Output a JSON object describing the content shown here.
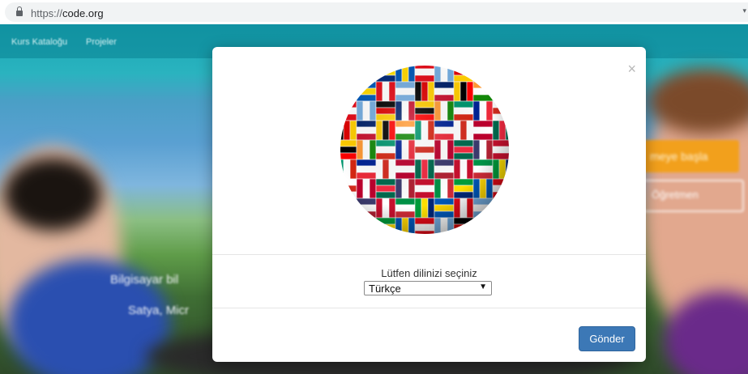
{
  "browser": {
    "url_scheme": "https://",
    "url_host": "code.org",
    "lock_icon": "lock-icon"
  },
  "page": {
    "nav": [
      "Kurs Kataloğu",
      "Projeler"
    ],
    "headline_fragment": "Bilgisayar bil",
    "subline_fragment": "Satya, Micr",
    "cta_primary_fragment": "meye başla",
    "cta_secondary_fragment": "Öğretmen"
  },
  "modal": {
    "close_label": "×",
    "image_icon": "flag-globe-icon",
    "prompt": "Lütfen dilinizi seçiniz",
    "language_select": {
      "selected": "Türkçe",
      "arrow": "▼"
    },
    "submit_label": "Gönder"
  },
  "colors": {
    "accent": "#3c78b6",
    "page_teal": "#1aa7b5",
    "cta_orange": "#f2a01c"
  }
}
